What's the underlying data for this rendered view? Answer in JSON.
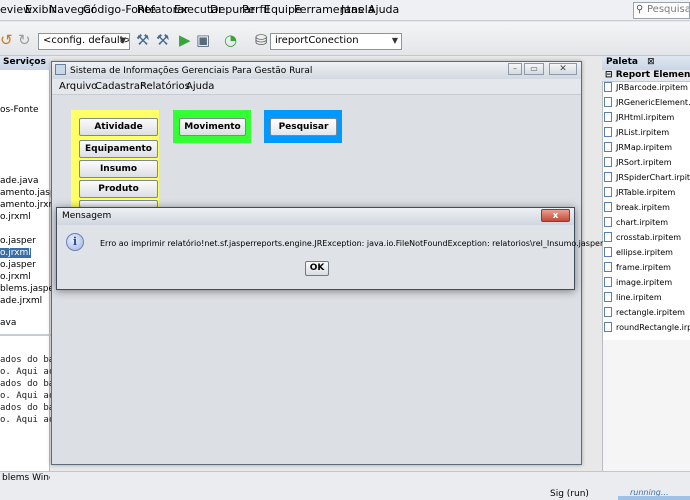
{
  "ide": {
    "menu": [
      "eview",
      "Exibir",
      "Navegar",
      "Código-Fonte",
      "Refatorar",
      "Executar",
      "Depurar",
      "Perfil",
      "Equipe",
      "Ferramentas",
      "Janela",
      "Ajuda"
    ],
    "search_placeholder": "Pesquisar",
    "config_combo": "<config. default>",
    "connection_combo": "ireportConection",
    "left_panel_title": "Serviços",
    "left_panel_items": [
      "os-Fonte",
      "ade.java",
      "amento.jasper",
      "amento.jrxml",
      "o.jrxml",
      "o.jasper",
      "o.jrxml",
      "o.jasper",
      "o.jrxml",
      "blems.jasper",
      "ade.jrxml",
      "ava"
    ],
    "output_lines": [
      "ados do banc",
      "o. Aqui aco",
      "ados do banc",
      "o. Aqui aco",
      "ados do banc",
      "o. Aqui aco"
    ],
    "problems_tab": "blems Window",
    "status_sig": "Sig (run)",
    "status_running": "running..."
  },
  "palette": {
    "title": "Paleta",
    "category": "Report Elements",
    "items": [
      "JRBarcode.irpitem",
      "JRGenericElement.irpitem",
      "JRHtml.irpitem",
      "JRList.irpitem",
      "JRMap.irpitem",
      "JRSort.irpitem",
      "JRSpiderChart.irpitem",
      "JRTable.irpitem",
      "break.irpitem",
      "chart.irpitem",
      "crosstab.irpitem",
      "ellipse.irpitem",
      "frame.irpitem",
      "image.irpitem",
      "line.irpitem",
      "rectangle.irpitem",
      "roundRectangle.irpitem"
    ]
  },
  "app": {
    "title": "Sistema de Informações Gerenciais Para Gestão Rural",
    "menu": [
      "Arquivo",
      "Cadastrar",
      "Relatórios",
      "Ajuda"
    ],
    "buttons": {
      "atividade": "Atividade",
      "equipamento": "Equipamento",
      "insumo": "Insumo",
      "produto": "Produto",
      "movimento": "Movimento",
      "pesquisar": "Pesquisar"
    },
    "colors": {
      "yellow": "#ffff66",
      "green": "#33ff33",
      "blue": "#0099ff"
    }
  },
  "dialog": {
    "title": "Mensagem",
    "message": "Erro ao imprimir relatório!net.sf.jasperreports.engine.JRException: java.io.FileNotFoundException: relatorios\\rel_Insumo.jasper",
    "ok": "OK",
    "close": "x"
  }
}
